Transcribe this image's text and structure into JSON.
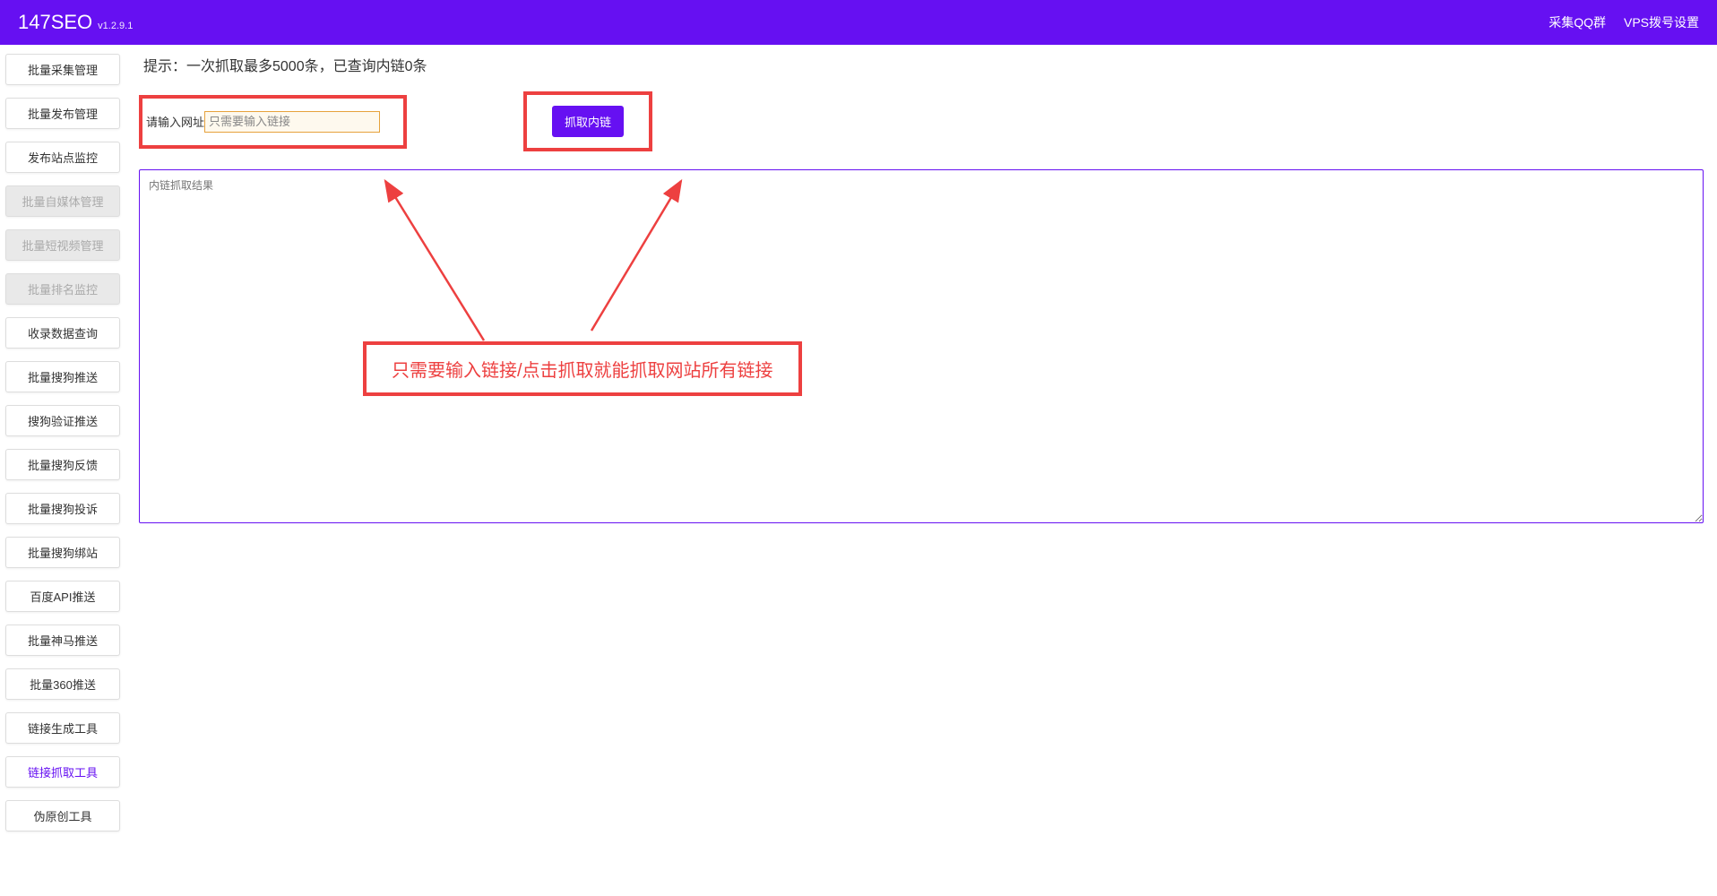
{
  "header": {
    "title": "147SEO",
    "version": "v1.2.9.1",
    "links": {
      "qq": "采集QQ群",
      "vps": "VPS拨号设置"
    }
  },
  "sidebar": {
    "items": [
      {
        "label": "批量采集管理",
        "state": "normal"
      },
      {
        "label": "批量发布管理",
        "state": "normal"
      },
      {
        "label": "发布站点监控",
        "state": "normal"
      },
      {
        "label": "批量自媒体管理",
        "state": "disabled"
      },
      {
        "label": "批量短视频管理",
        "state": "disabled"
      },
      {
        "label": "批量排名监控",
        "state": "disabled"
      },
      {
        "label": "收录数据查询",
        "state": "normal"
      },
      {
        "label": "批量搜狗推送",
        "state": "normal"
      },
      {
        "label": "搜狗验证推送",
        "state": "normal"
      },
      {
        "label": "批量搜狗反馈",
        "state": "normal"
      },
      {
        "label": "批量搜狗投诉",
        "state": "normal"
      },
      {
        "label": "批量搜狗绑站",
        "state": "normal"
      },
      {
        "label": "百度API推送",
        "state": "normal"
      },
      {
        "label": "批量神马推送",
        "state": "normal"
      },
      {
        "label": "批量360推送",
        "state": "normal"
      },
      {
        "label": "链接生成工具",
        "state": "normal"
      },
      {
        "label": "链接抓取工具",
        "state": "active"
      },
      {
        "label": "伪原创工具",
        "state": "normal"
      }
    ]
  },
  "content": {
    "hint": "提示：一次抓取最多5000条，已查询内链0条",
    "input_label": "请输入网址",
    "input_placeholder": "只需要输入链接",
    "fetch_button": "抓取内链",
    "result_placeholder": "内链抓取结果"
  },
  "annotation": {
    "text": "只需要输入链接/点击抓取就能抓取网站所有链接",
    "color": "#ed4040"
  }
}
